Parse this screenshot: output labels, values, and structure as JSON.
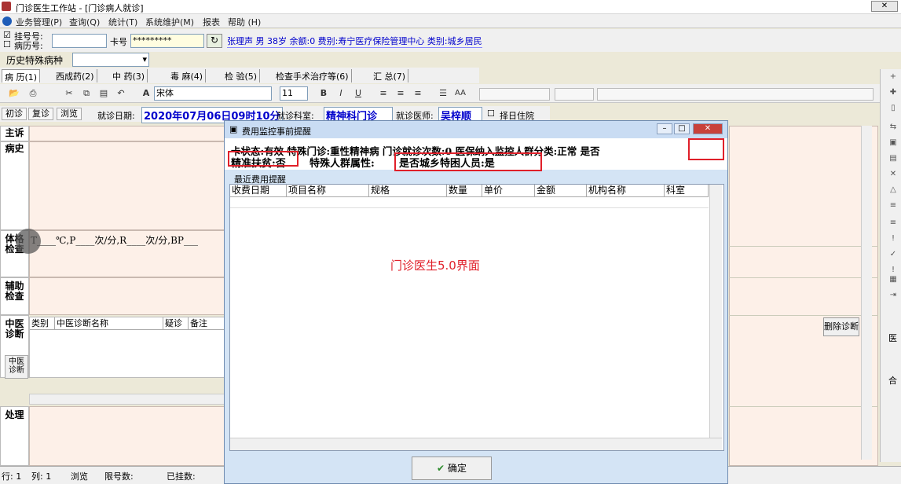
{
  "window": {
    "title": "门诊医生工作站 - [门诊病人就诊]"
  },
  "menu": [
    "业务管理(P)",
    "查询(Q)",
    "统计(T)",
    "系统维护(M)",
    "报表",
    "帮助 (H)"
  ],
  "patient": {
    "reg_no_label": "挂号号:",
    "record_no_label": "病历号:",
    "card_label": "卡号",
    "card_value": "*********",
    "summary": "张理声  男  38岁  余额:0  费别:寿宁医疗保险管理中心  类别:城乡居民",
    "history_label": "历史特殊病种"
  },
  "tabs": [
    "病 历(1)",
    "西成药(2)",
    "中 药(3)",
    "毒 麻(4)",
    "检 验(5)",
    "检查手术治疗等(6)",
    "汇 总(7)"
  ],
  "toolbar": {
    "font": "宋体",
    "size": "11"
  },
  "visit": {
    "first_visit": "初诊",
    "revisit": "复诊",
    "browse": "浏览",
    "date_label": "就诊日期:",
    "date_value": "2020年07月06日09时10分",
    "dept_label": "就诊科室:",
    "dept_value": "精神科门诊",
    "doctor_label": "就诊医师:",
    "doctor_value": "吴梓顺",
    "hospitalize_label": "择日住院"
  },
  "sections": {
    "chief": "主诉",
    "history": "病史",
    "exam": "体格检查",
    "aux": "辅助检查",
    "tcm_diag": "中医诊断",
    "tcm_diag2": "中医诊断",
    "treatment": "处理"
  },
  "vitals": "T____℃,P____次/分,R____次/分,BP___",
  "tcm_columns": [
    "类别",
    "中医诊断名称",
    "疑诊",
    "备注"
  ],
  "delete_diag": "删除诊断",
  "right_labels": {
    "doctor": "医",
    "joint": "合"
  },
  "dialog": {
    "title": "费用监控事前提醒",
    "line1": "卡状态:有效   特殊门诊:重性精神病   门诊就诊次数:0   医保纳入监控人群分类:正常   是否",
    "line2a": "精准扶贫:否",
    "line2b": "特殊人群属性:",
    "line2c": "是否城乡特困人员:是",
    "recent_label": "最近费用提醒",
    "columns": [
      "收费日期",
      "项目名称",
      "规格",
      "数量",
      "单价",
      "金额",
      "机构名称",
      "科室"
    ],
    "watermark": "门诊医生5.0界面",
    "ok": "确定"
  },
  "status": {
    "row": "行: 1",
    "col": "列: 1",
    "browse": "浏览",
    "limit": "限号数:",
    "registered": "已挂数:"
  }
}
